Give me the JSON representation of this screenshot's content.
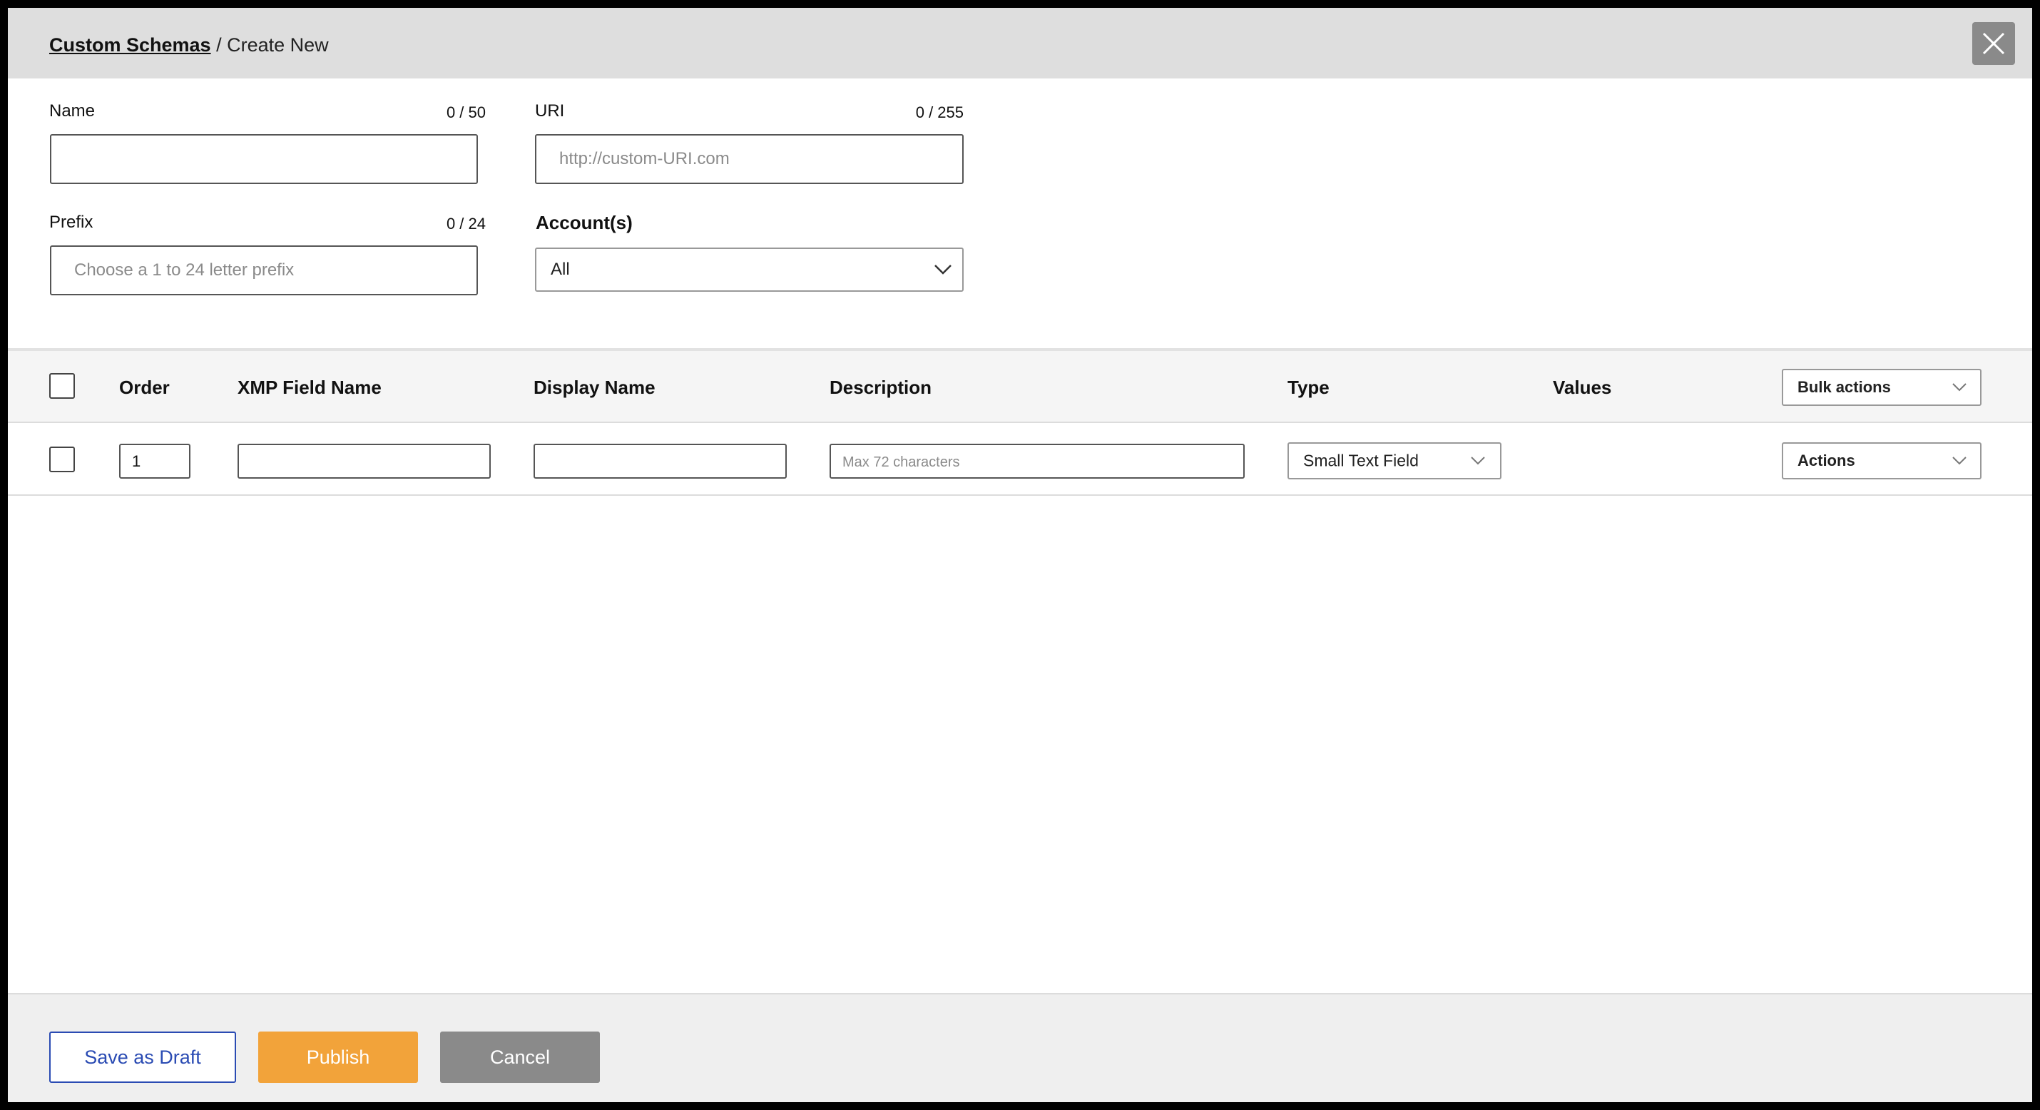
{
  "breadcrumb": {
    "parent": "Custom Schemas",
    "separator": " / ",
    "current": "Create New"
  },
  "form": {
    "name": {
      "label": "Name",
      "counter": "0 / 50",
      "value": "",
      "placeholder": ""
    },
    "uri": {
      "label": "URI",
      "counter": "0 / 255",
      "value": "",
      "placeholder": "http://custom-URI.com"
    },
    "prefix": {
      "label": "Prefix",
      "counter": "0 / 24",
      "value": "",
      "placeholder": "Choose a 1 to 24 letter prefix"
    },
    "accounts": {
      "label": "Account(s)",
      "selected": "All"
    }
  },
  "table": {
    "headers": {
      "order": "Order",
      "xmp_field_name": "XMP Field Name",
      "display_name": "Display Name",
      "description": "Description",
      "type": "Type",
      "values": "Values"
    },
    "bulk_actions": "Bulk actions",
    "rows": [
      {
        "order": "1",
        "xmp_field_name": "",
        "display_name": "",
        "description": "",
        "description_placeholder": "Max 72 characters",
        "type": "Small Text Field",
        "actions": "Actions"
      }
    ]
  },
  "footer": {
    "save_draft": "Save as Draft",
    "publish": "Publish",
    "cancel": "Cancel"
  },
  "icons": {
    "close": "close-icon",
    "dropdown": "chevron-down-icon"
  },
  "colors": {
    "header_bg": "#dedede",
    "draft_border": "#2a4bb3",
    "publish_bg": "#f2a33a",
    "cancel_bg": "#8a8a8a"
  }
}
